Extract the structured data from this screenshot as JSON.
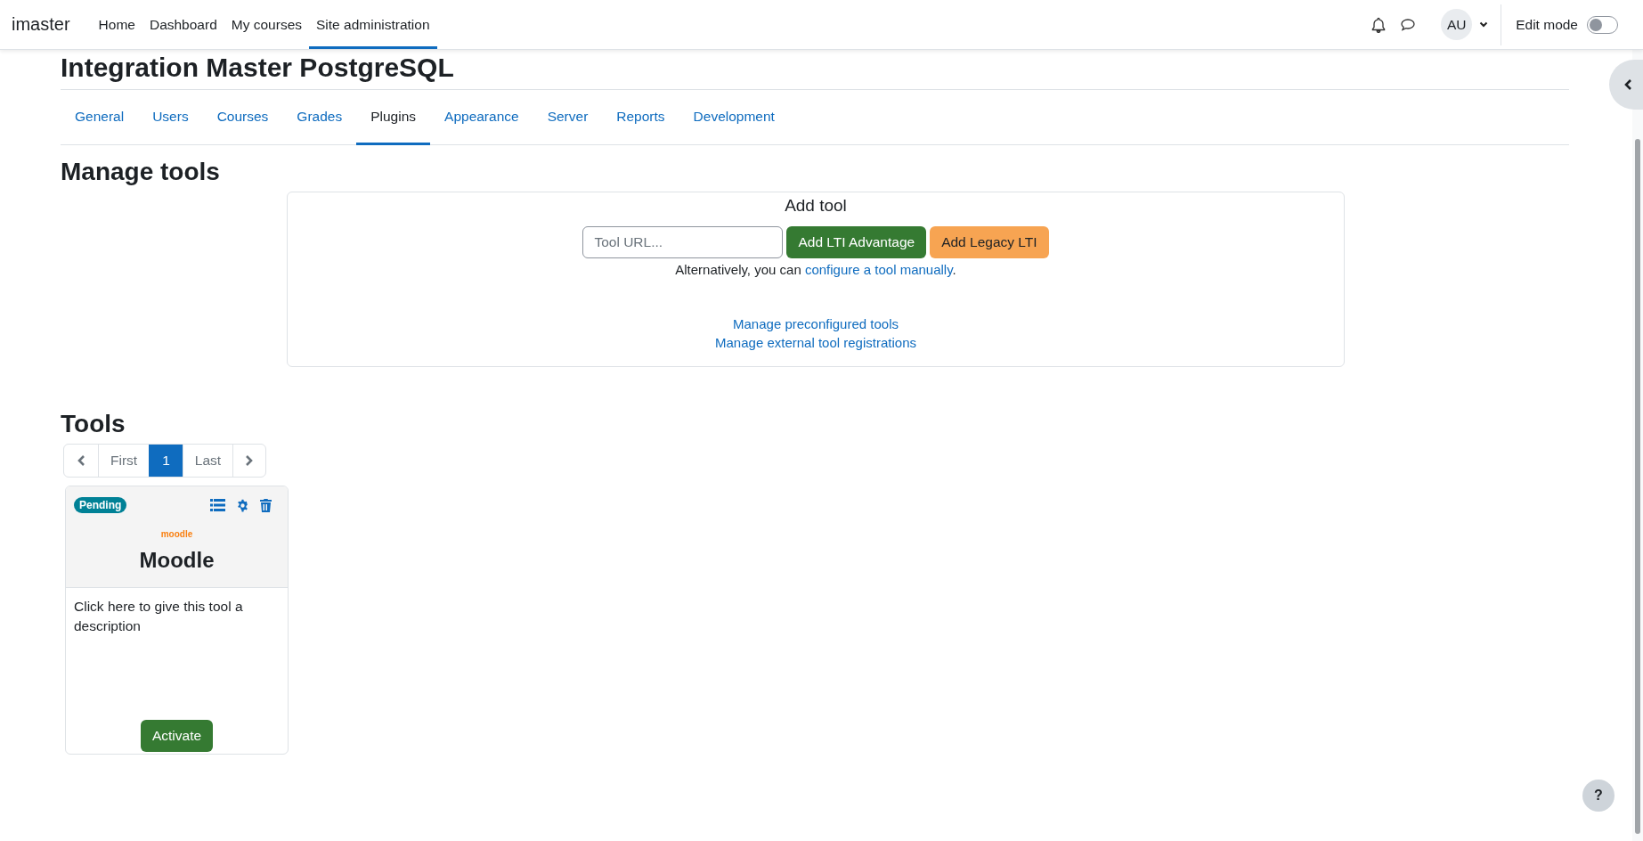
{
  "navbar": {
    "brand": "imaster",
    "links": [
      {
        "label": "Home",
        "selected": false
      },
      {
        "label": "Dashboard",
        "selected": false
      },
      {
        "label": "My courses",
        "selected": false
      },
      {
        "label": "Site administration",
        "selected": true
      }
    ],
    "avatar": "AU",
    "edit_mode": {
      "label": "Edit mode",
      "on": false
    }
  },
  "page_title": "Integration Master PostgreSQL",
  "tabs": [
    {
      "label": "General",
      "selected": false
    },
    {
      "label": "Users",
      "selected": false
    },
    {
      "label": "Courses",
      "selected": false
    },
    {
      "label": "Grades",
      "selected": false
    },
    {
      "label": "Plugins",
      "selected": true
    },
    {
      "label": "Appearance",
      "selected": false
    },
    {
      "label": "Server",
      "selected": false
    },
    {
      "label": "Reports",
      "selected": false
    },
    {
      "label": "Development",
      "selected": false
    }
  ],
  "heading": "Manage tools",
  "add_tool": {
    "title": "Add tool",
    "url_placeholder": "Tool URL...",
    "buttons": [
      {
        "label": "Add LTI Advantage",
        "kind": "primary"
      },
      {
        "label": "Add Legacy LTI",
        "kind": "warning"
      }
    ],
    "alt_text": "Alternatively, you can ",
    "alt_link": "configure a tool manually",
    "alt_end": ".",
    "links": [
      "Manage preconfigured tools",
      "Manage external tool registrations"
    ]
  },
  "tools_heading": "Tools",
  "pagination": {
    "first": "First",
    "last": "Last",
    "pages": [
      {
        "label": "1",
        "selected": true
      }
    ]
  },
  "tools": [
    {
      "status": "Pending",
      "logo": "moodle",
      "name": "Moodle",
      "description": "Click here to give this tool a description",
      "action": "Activate"
    }
  ],
  "help": "?"
}
